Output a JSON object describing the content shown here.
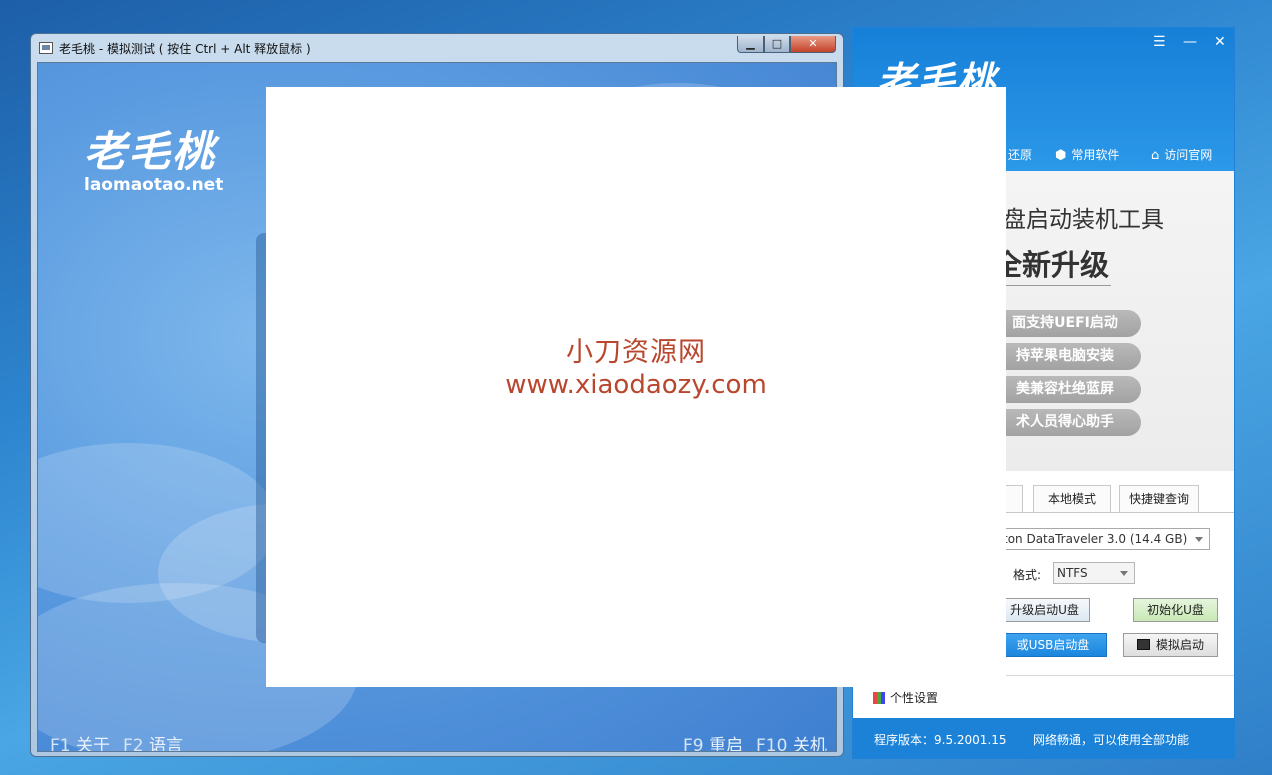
{
  "vm_window": {
    "title": "老毛桃 - 模拟测试 ( 按住 Ctrl + Alt 释放鼠标 )",
    "min_label": "▁",
    "max_label": "□",
    "close_label": "✕",
    "logo_cn": "老毛桃",
    "logo_en": "laomaotao.net",
    "fkeys_left": [
      {
        "key": "F1",
        "label": "关于"
      },
      {
        "key": "F2",
        "label": "语言"
      }
    ],
    "fkeys_right": [
      {
        "key": "F9",
        "label": "重启"
      },
      {
        "key": "F10",
        "label": "关机"
      }
    ]
  },
  "app_window": {
    "logo_cn": "老毛桃",
    "controls": {
      "menu": "☰",
      "min": "—",
      "close": "✕"
    },
    "nav": [
      {
        "label": "还原",
        "icon": "restore-icon"
      },
      {
        "label": "常用软件",
        "icon": "cube-icon"
      },
      {
        "label": "访问官网",
        "icon": "home-icon"
      }
    ],
    "banner": {
      "title": "盘启动装机工具",
      "subtitle": "全新升级",
      "features": [
        "面支持UEFI启动",
        "持苹果电脑安装",
        "美兼容杜绝蓝屏",
        "术人员得心助手"
      ]
    },
    "tabs": [
      "本地模式",
      "快捷键查询"
    ],
    "device": "ton DataTraveler 3.0 (14.4 GB)",
    "format_label": "格式:",
    "format_value": "NTFS",
    "buttons": {
      "upgrade": "升级启动U盘",
      "init": "初始化U盘",
      "make": "或USB启动盘",
      "simulate": "模拟启动"
    },
    "personal": "个性设置",
    "version_label": "程序版本：9.5.2001.15",
    "network_label": "网络畅通，可以使用全部功能"
  },
  "watermark": {
    "line1": "小刀资源网",
    "line2": "www.xiaodaozy.com"
  },
  "colors": {
    "app_blue": "#1c82d8",
    "watermark": "#b9472e"
  }
}
